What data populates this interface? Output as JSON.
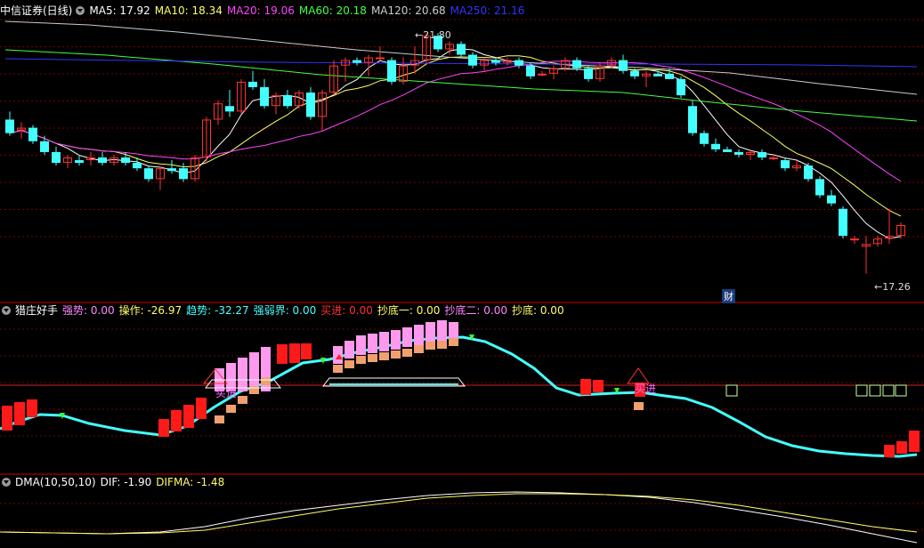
{
  "panel1": {
    "title": "中信证券(日线)",
    "ma": [
      {
        "label": "MA5: 17.92",
        "color": "#ffffff"
      },
      {
        "label": "MA10: 18.34",
        "color": "#ffff66"
      },
      {
        "label": "MA20: 19.06",
        "color": "#ff44ff"
      },
      {
        "label": "MA60: 20.18",
        "color": "#44ff44"
      },
      {
        "label": "MA120: 20.68",
        "color": "#cccccc"
      },
      {
        "label": "MA250: 21.16",
        "color": "#3333ff"
      }
    ],
    "high_label": "21.80",
    "low_label": "17.26",
    "fin_marker": "财"
  },
  "panel2": {
    "title": "猎庄好手",
    "fields": [
      {
        "label": "强势: 0.00",
        "color": "#ff88ff"
      },
      {
        "label": "操作: -26.97",
        "color": "#ffff66"
      },
      {
        "label": "趋势: -32.27",
        "color": "#44ffff"
      },
      {
        "label": "强弱界: 0.00",
        "color": "#44ffff"
      },
      {
        "label": "买进: 0.00",
        "color": "#ff3333"
      },
      {
        "label": "抄底一: 0.00",
        "color": "#ffff66"
      },
      {
        "label": "抄底二: 0.00",
        "color": "#ff88ff"
      },
      {
        "label": "抄底: 0.00",
        "color": "#ffff66"
      }
    ],
    "buy_text_1": "买进",
    "buy_text_2": "买进"
  },
  "panel3": {
    "title": "DMA(10,50,10)",
    "fields": [
      {
        "label": "DIF: -1.90",
        "color": "#ffffff"
      },
      {
        "label": "DIFMA: -1.48",
        "color": "#ffff66"
      }
    ]
  },
  "colors": {
    "up": "#ff3333",
    "down": "#44ffff",
    "grid": "#7a0000",
    "ma5": "#ffffff",
    "ma10": "#ffff66",
    "ma20": "#ff44ff",
    "ma60": "#44ff44",
    "ma120": "#cccccc",
    "ma250": "#3333ff",
    "pink": "#ff99ee",
    "orange": "#f0a070",
    "trend": "#44ffff",
    "divider": "#cc0000"
  },
  "chart_data": [
    {
      "type": "candlestick",
      "title": "中信证券(日线)",
      "ohlc": [
        [
          20.2,
          20.35,
          19.9,
          19.95
        ],
        [
          20.0,
          20.15,
          19.85,
          20.05
        ],
        [
          20.05,
          20.1,
          19.75,
          19.8
        ],
        [
          19.8,
          19.9,
          19.55,
          19.6
        ],
        [
          19.6,
          19.7,
          19.35,
          19.4
        ],
        [
          19.4,
          19.55,
          19.3,
          19.5
        ],
        [
          19.45,
          19.55,
          19.35,
          19.4
        ],
        [
          19.45,
          19.6,
          19.35,
          19.5
        ],
        [
          19.5,
          19.6,
          19.35,
          19.4
        ],
        [
          19.4,
          19.55,
          19.35,
          19.5
        ],
        [
          19.5,
          19.6,
          19.35,
          19.4
        ],
        [
          19.4,
          19.5,
          19.25,
          19.3
        ],
        [
          19.3,
          19.35,
          19.05,
          19.1
        ],
        [
          19.1,
          19.35,
          18.9,
          19.3
        ],
        [
          19.3,
          19.45,
          19.2,
          19.25
        ],
        [
          19.3,
          19.4,
          19.05,
          19.1
        ],
        [
          19.1,
          19.55,
          19.05,
          19.5
        ],
        [
          19.5,
          20.25,
          19.4,
          20.2
        ],
        [
          20.2,
          20.55,
          20.1,
          20.5
        ],
        [
          20.45,
          20.75,
          20.25,
          20.35
        ],
        [
          20.35,
          20.95,
          20.3,
          20.9
        ],
        [
          20.9,
          21.1,
          20.75,
          20.8
        ],
        [
          20.8,
          20.95,
          20.4,
          20.45
        ],
        [
          20.45,
          20.7,
          20.3,
          20.65
        ],
        [
          20.65,
          20.75,
          20.4,
          20.45
        ],
        [
          20.45,
          20.75,
          20.4,
          20.7
        ],
        [
          20.7,
          20.8,
          20.2,
          20.25
        ],
        [
          20.25,
          20.75,
          20.0,
          20.7
        ],
        [
          20.7,
          21.3,
          20.65,
          21.2
        ],
        [
          21.2,
          21.35,
          20.9,
          21.3
        ],
        [
          21.3,
          21.35,
          21.2,
          21.25
        ],
        [
          21.25,
          21.4,
          21.0,
          21.35
        ],
        [
          21.35,
          21.55,
          21.3,
          21.35
        ],
        [
          21.3,
          21.35,
          20.85,
          20.9
        ],
        [
          20.9,
          21.35,
          20.85,
          21.2
        ],
        [
          21.2,
          21.55,
          21.05,
          21.3
        ],
        [
          21.3,
          21.8,
          21.2,
          21.75
        ],
        [
          21.75,
          21.8,
          21.45,
          21.5
        ],
        [
          21.5,
          21.65,
          21.4,
          21.6
        ],
        [
          21.6,
          21.65,
          21.35,
          21.4
        ],
        [
          21.4,
          21.45,
          21.15,
          21.2
        ],
        [
          21.2,
          21.35,
          21.1,
          21.3
        ],
        [
          21.3,
          21.35,
          21.2,
          21.25
        ],
        [
          21.25,
          21.35,
          21.2,
          21.3
        ],
        [
          21.3,
          21.35,
          21.15,
          21.2
        ],
        [
          21.2,
          21.25,
          20.95,
          21.0
        ],
        [
          21.05,
          21.1,
          21.0,
          21.05
        ],
        [
          21.05,
          21.2,
          20.95,
          21.15
        ],
        [
          21.15,
          21.35,
          21.1,
          21.3
        ],
        [
          21.3,
          21.35,
          21.1,
          21.15
        ],
        [
          21.15,
          21.2,
          20.9,
          20.95
        ],
        [
          20.95,
          21.25,
          20.9,
          21.2
        ],
        [
          21.2,
          21.35,
          21.15,
          21.3
        ],
        [
          21.3,
          21.4,
          21.05,
          21.1
        ],
        [
          21.1,
          21.15,
          20.95,
          21.0
        ],
        [
          21.0,
          21.1,
          20.8,
          21.05
        ],
        [
          21.05,
          21.1,
          21.0,
          21.0
        ],
        [
          21.05,
          21.15,
          20.95,
          20.95
        ],
        [
          20.95,
          21.0,
          20.6,
          20.65
        ],
        [
          20.45,
          20.55,
          19.9,
          19.95
        ],
        [
          19.95,
          20.0,
          19.7,
          19.75
        ],
        [
          19.75,
          19.85,
          19.6,
          19.65
        ],
        [
          19.65,
          19.7,
          19.6,
          19.6
        ],
        [
          19.6,
          19.65,
          19.5,
          19.55
        ],
        [
          19.55,
          19.65,
          19.45,
          19.6
        ],
        [
          19.6,
          19.65,
          19.45,
          19.5
        ],
        [
          19.5,
          19.55,
          19.45,
          19.5
        ],
        [
          19.45,
          19.5,
          19.25,
          19.3
        ],
        [
          19.3,
          19.45,
          19.25,
          19.35
        ],
        [
          19.35,
          19.4,
          19.05,
          19.1
        ],
        [
          19.1,
          19.15,
          18.75,
          18.8
        ],
        [
          18.8,
          18.9,
          18.6,
          18.65
        ],
        [
          18.55,
          18.6,
          18.0,
          18.05
        ],
        [
          18.0,
          18.05,
          17.9,
          18.0
        ],
        [
          17.85,
          18.05,
          17.35,
          17.9
        ],
        [
          17.9,
          18.05,
          17.85,
          18.0
        ],
        [
          18.0,
          18.55,
          17.9,
          18.05
        ],
        [
          18.05,
          18.3,
          18.0,
          18.25
        ]
      ]
    },
    {
      "type": "line",
      "title": "DMA(10,50,10)",
      "series": [
        {
          "name": "DIF",
          "values": [
            -1.9
          ]
        },
        {
          "name": "DIFMA",
          "values": [
            -1.48
          ]
        }
      ]
    }
  ]
}
